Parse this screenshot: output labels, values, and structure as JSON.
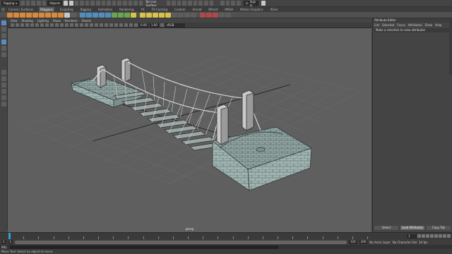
{
  "status_line": {
    "menu_set": "Rigging",
    "object_field": "Objects",
    "live_surface": "No Live Surface",
    "symmetry": "Symmetry: Off",
    "sign_in": "Sign In"
  },
  "shelf_tabs": [
    "Curves / Surfaces",
    "Polygons",
    "Sculpting",
    "Rigging",
    "Animation",
    "Rendering",
    "FX",
    "FX Caching",
    "Custom",
    "Arnold",
    "Bifrost",
    "MASH",
    "Motion Graphics",
    "XGen"
  ],
  "shelf_tab_active_index": 1,
  "panel_menu": [
    "View",
    "Shading",
    "Lighting",
    "Show",
    "Renderer",
    "Panels"
  ],
  "panel_toolbar": {
    "near_clip": "0.00",
    "far_clip": "1.00",
    "color_space": "sRGB gamma"
  },
  "viewport": {
    "camera_label": "persp"
  },
  "attribute_editor": {
    "title": "Attribute Editor",
    "menu": [
      "List",
      "Selected",
      "Focus",
      "Attributes",
      "Show",
      "Help"
    ],
    "message": "Make a selection to view attributes",
    "tabs": [
      "Select",
      "Load Attributes",
      "Copy Tab"
    ],
    "active_tab_index": 1
  },
  "time_slider": {
    "tick_labels": [
      "1",
      "5",
      "10",
      "15",
      "20",
      "25",
      "30",
      "35",
      "40",
      "45",
      "50",
      "55",
      "60",
      "65",
      "70",
      "75",
      "80",
      "85",
      "90",
      "95",
      "100",
      "105",
      "110",
      "115",
      "120"
    ],
    "current_frame": "1"
  },
  "range_slider": {
    "start": "1",
    "end": "120",
    "range_end": "120",
    "total_end": "200",
    "anim_layer": "No Anim Layer",
    "char_set": "No Character Set",
    "fps": "24 fps"
  },
  "command_line": {
    "lang": "MEL"
  },
  "help_line": {
    "text": "Move Tool: Select an object to move."
  }
}
